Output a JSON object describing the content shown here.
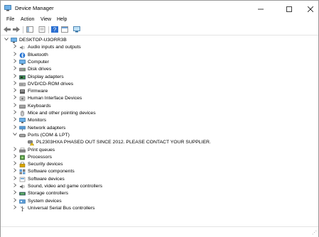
{
  "window": {
    "title": "Device Manager"
  },
  "menu": [
    {
      "label": "File"
    },
    {
      "label": "Action"
    },
    {
      "label": "View"
    },
    {
      "label": "Help"
    }
  ],
  "tree": {
    "root": {
      "label": "DESKTOP-U3ORR3B",
      "icon": "computer-icon"
    },
    "categories": [
      {
        "label": "Audio inputs and outputs",
        "icon": "speaker-icon"
      },
      {
        "label": "Bluetooth",
        "icon": "bluetooth-icon"
      },
      {
        "label": "Computer",
        "icon": "computer-icon"
      },
      {
        "label": "Disk drives",
        "icon": "disk-drive-icon"
      },
      {
        "label": "Display adapters",
        "icon": "display-adapter-icon"
      },
      {
        "label": "DVD/CD-ROM drives",
        "icon": "dvd-drive-icon"
      },
      {
        "label": "Firmware",
        "icon": "firmware-icon"
      },
      {
        "label": "Human Interface Devices",
        "icon": "hid-icon"
      },
      {
        "label": "Keyboards",
        "icon": "keyboard-icon"
      },
      {
        "label": "Mice and other pointing devices",
        "icon": "mouse-icon"
      },
      {
        "label": "Monitors",
        "icon": "monitor-icon"
      },
      {
        "label": "Network adapters",
        "icon": "network-adapter-icon"
      },
      {
        "label": "Ports (COM & LPT)",
        "icon": "port-icon",
        "expanded": true,
        "children": [
          {
            "label": "PL2303HXA PHASED OUT SINCE 2012. PLEASE CONTACT YOUR SUPPLIER.",
            "icon": "port-device-warning-icon"
          }
        ]
      },
      {
        "label": "Print queues",
        "icon": "printer-icon"
      },
      {
        "label": "Processors",
        "icon": "processor-icon"
      },
      {
        "label": "Security devices",
        "icon": "security-device-icon"
      },
      {
        "label": "Software components",
        "icon": "software-component-icon"
      },
      {
        "label": "Software devices",
        "icon": "software-device-icon"
      },
      {
        "label": "Sound, video and game controllers",
        "icon": "sound-controller-icon"
      },
      {
        "label": "Storage controllers",
        "icon": "storage-controller-icon"
      },
      {
        "label": "System devices",
        "icon": "system-device-icon"
      },
      {
        "label": "Universal Serial Bus controllers",
        "icon": "usb-icon"
      }
    ]
  },
  "colors": {
    "accent": "#1e88d8",
    "selection": "#cce8ff",
    "warning": "#f2c200"
  }
}
